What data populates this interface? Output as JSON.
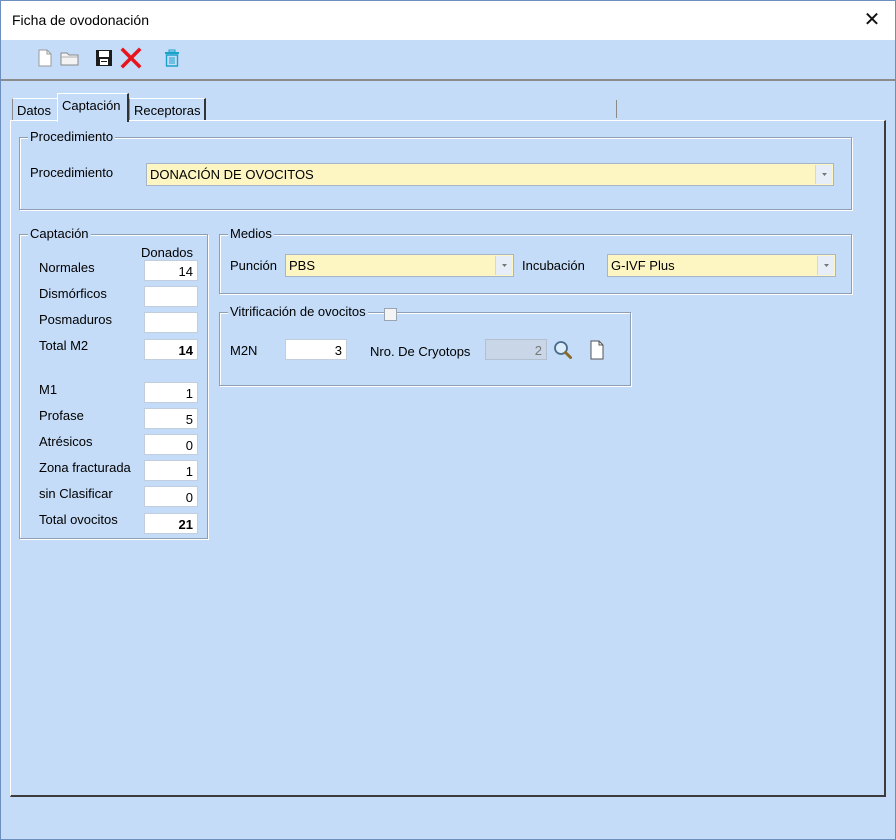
{
  "window": {
    "title": "Ficha de ovodonación",
    "close_glyph": "✕"
  },
  "toolbar": {
    "icons": [
      "new-document-icon",
      "open-folder-icon",
      "save-icon",
      "delete-icon",
      "trash-icon"
    ]
  },
  "tabs": [
    "Datos",
    "Captación",
    "Receptoras"
  ],
  "procedimiento": {
    "group_title": "Procedimiento",
    "label": "Procedimiento",
    "value": "DONACIÓN DE OVOCITOS"
  },
  "captacion": {
    "group_title": "Captación",
    "column_header": "Donados",
    "rows": [
      {
        "label": "Normales",
        "value": "14"
      },
      {
        "label": "Dismórficos",
        "value": ""
      },
      {
        "label": "Posmaduros",
        "value": ""
      },
      {
        "label": "Total M2",
        "value": "14"
      },
      {
        "label": "M1",
        "value": "1"
      },
      {
        "label": "Profase",
        "value": "5"
      },
      {
        "label": "Atrésicos",
        "value": "0"
      },
      {
        "label": "Zona fracturada",
        "value": "1"
      },
      {
        "label": "sin Clasificar",
        "value": "0"
      },
      {
        "label": "Total ovocitos",
        "value": "21"
      }
    ]
  },
  "medios": {
    "group_title": "Medios",
    "puncion_label": "Punción",
    "puncion_value": "PBS",
    "incubacion_label": "Incubación",
    "incubacion_value": "G-IVF Plus"
  },
  "vitrificacion": {
    "group_title": "Vitrificación de ovocitos",
    "checked": false,
    "m2n_label": "M2N",
    "m2n_value": "3",
    "cryotops_label": "Nro. De Cryotops",
    "cryotops_value": "2"
  },
  "colors": {
    "background": "#c4dcf8",
    "input_yellow": "#fdf6c3",
    "delete_red": "#e8141b",
    "trash_teal": "#1aa3c9"
  }
}
